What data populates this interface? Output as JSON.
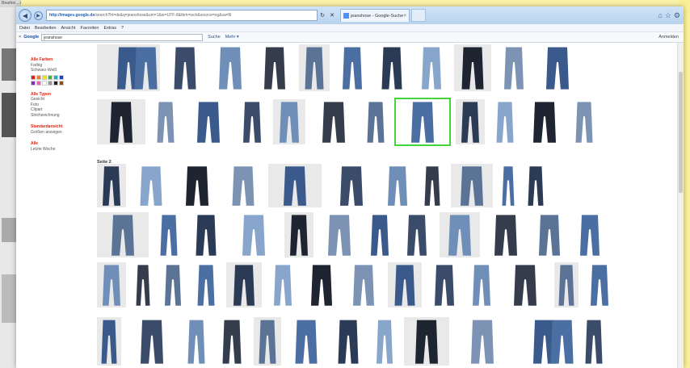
{
  "background_window": {
    "strip_text": "Bearbei... Ansicht"
  },
  "titlebar": {
    "back_glyph": "◀",
    "forward_glyph": "▶",
    "address_host": "http://images.google.de",
    "address_rest": "/search?hl=de&q=jeanshose&um=1&ie=UTF-8&tbm=isch&source=og&sa=N",
    "refresh_glyph": "↻",
    "stop_glyph": "✕",
    "tab_title": "jeanshose - Google-Suche",
    "tab_close": "×",
    "win_min": "⌂",
    "win_max": "☆",
    "win_close": "⚙"
  },
  "menubar": {
    "items": [
      "Datei",
      "Bearbeiten",
      "Ansicht",
      "Favoriten",
      "Extras",
      "?"
    ]
  },
  "toolbar": {
    "close_glyph": "×",
    "logo": "Google",
    "search_value": "jeanshose",
    "suche_label": "Suche",
    "mehr_label": "Mehr ▾",
    "right_label": "Anmelden"
  },
  "sidebar": {
    "colors_heading": "Alle Farben",
    "colors_items": [
      "Farbig",
      "Schwarz-Weiß"
    ],
    "swatch_colors": [
      "#e02020",
      "#f08020",
      "#f0e020",
      "#40b040",
      "#20b0b0",
      "#2040d0",
      "#8030c0",
      "#f060b0",
      "#ffffff",
      "#999999",
      "#202020",
      "#8a5020"
    ],
    "types_heading": "Alle Typen",
    "types_items": [
      "Gesicht",
      "Foto",
      "Clipart",
      "Strichzeichnung"
    ],
    "standard_heading": "Standardansicht",
    "standard_items": [
      "Größen anzeigen"
    ],
    "time_heading": "Alle",
    "time_items": [
      "Letzte Woche"
    ]
  },
  "page_label": "Seite 2",
  "icons": {
    "back": "back-arrow-icon",
    "forward": "forward-arrow-icon",
    "refresh": "refresh-icon",
    "stop": "stop-icon",
    "home": "home-icon",
    "star": "favorites-icon",
    "gear": "gear-icon"
  }
}
